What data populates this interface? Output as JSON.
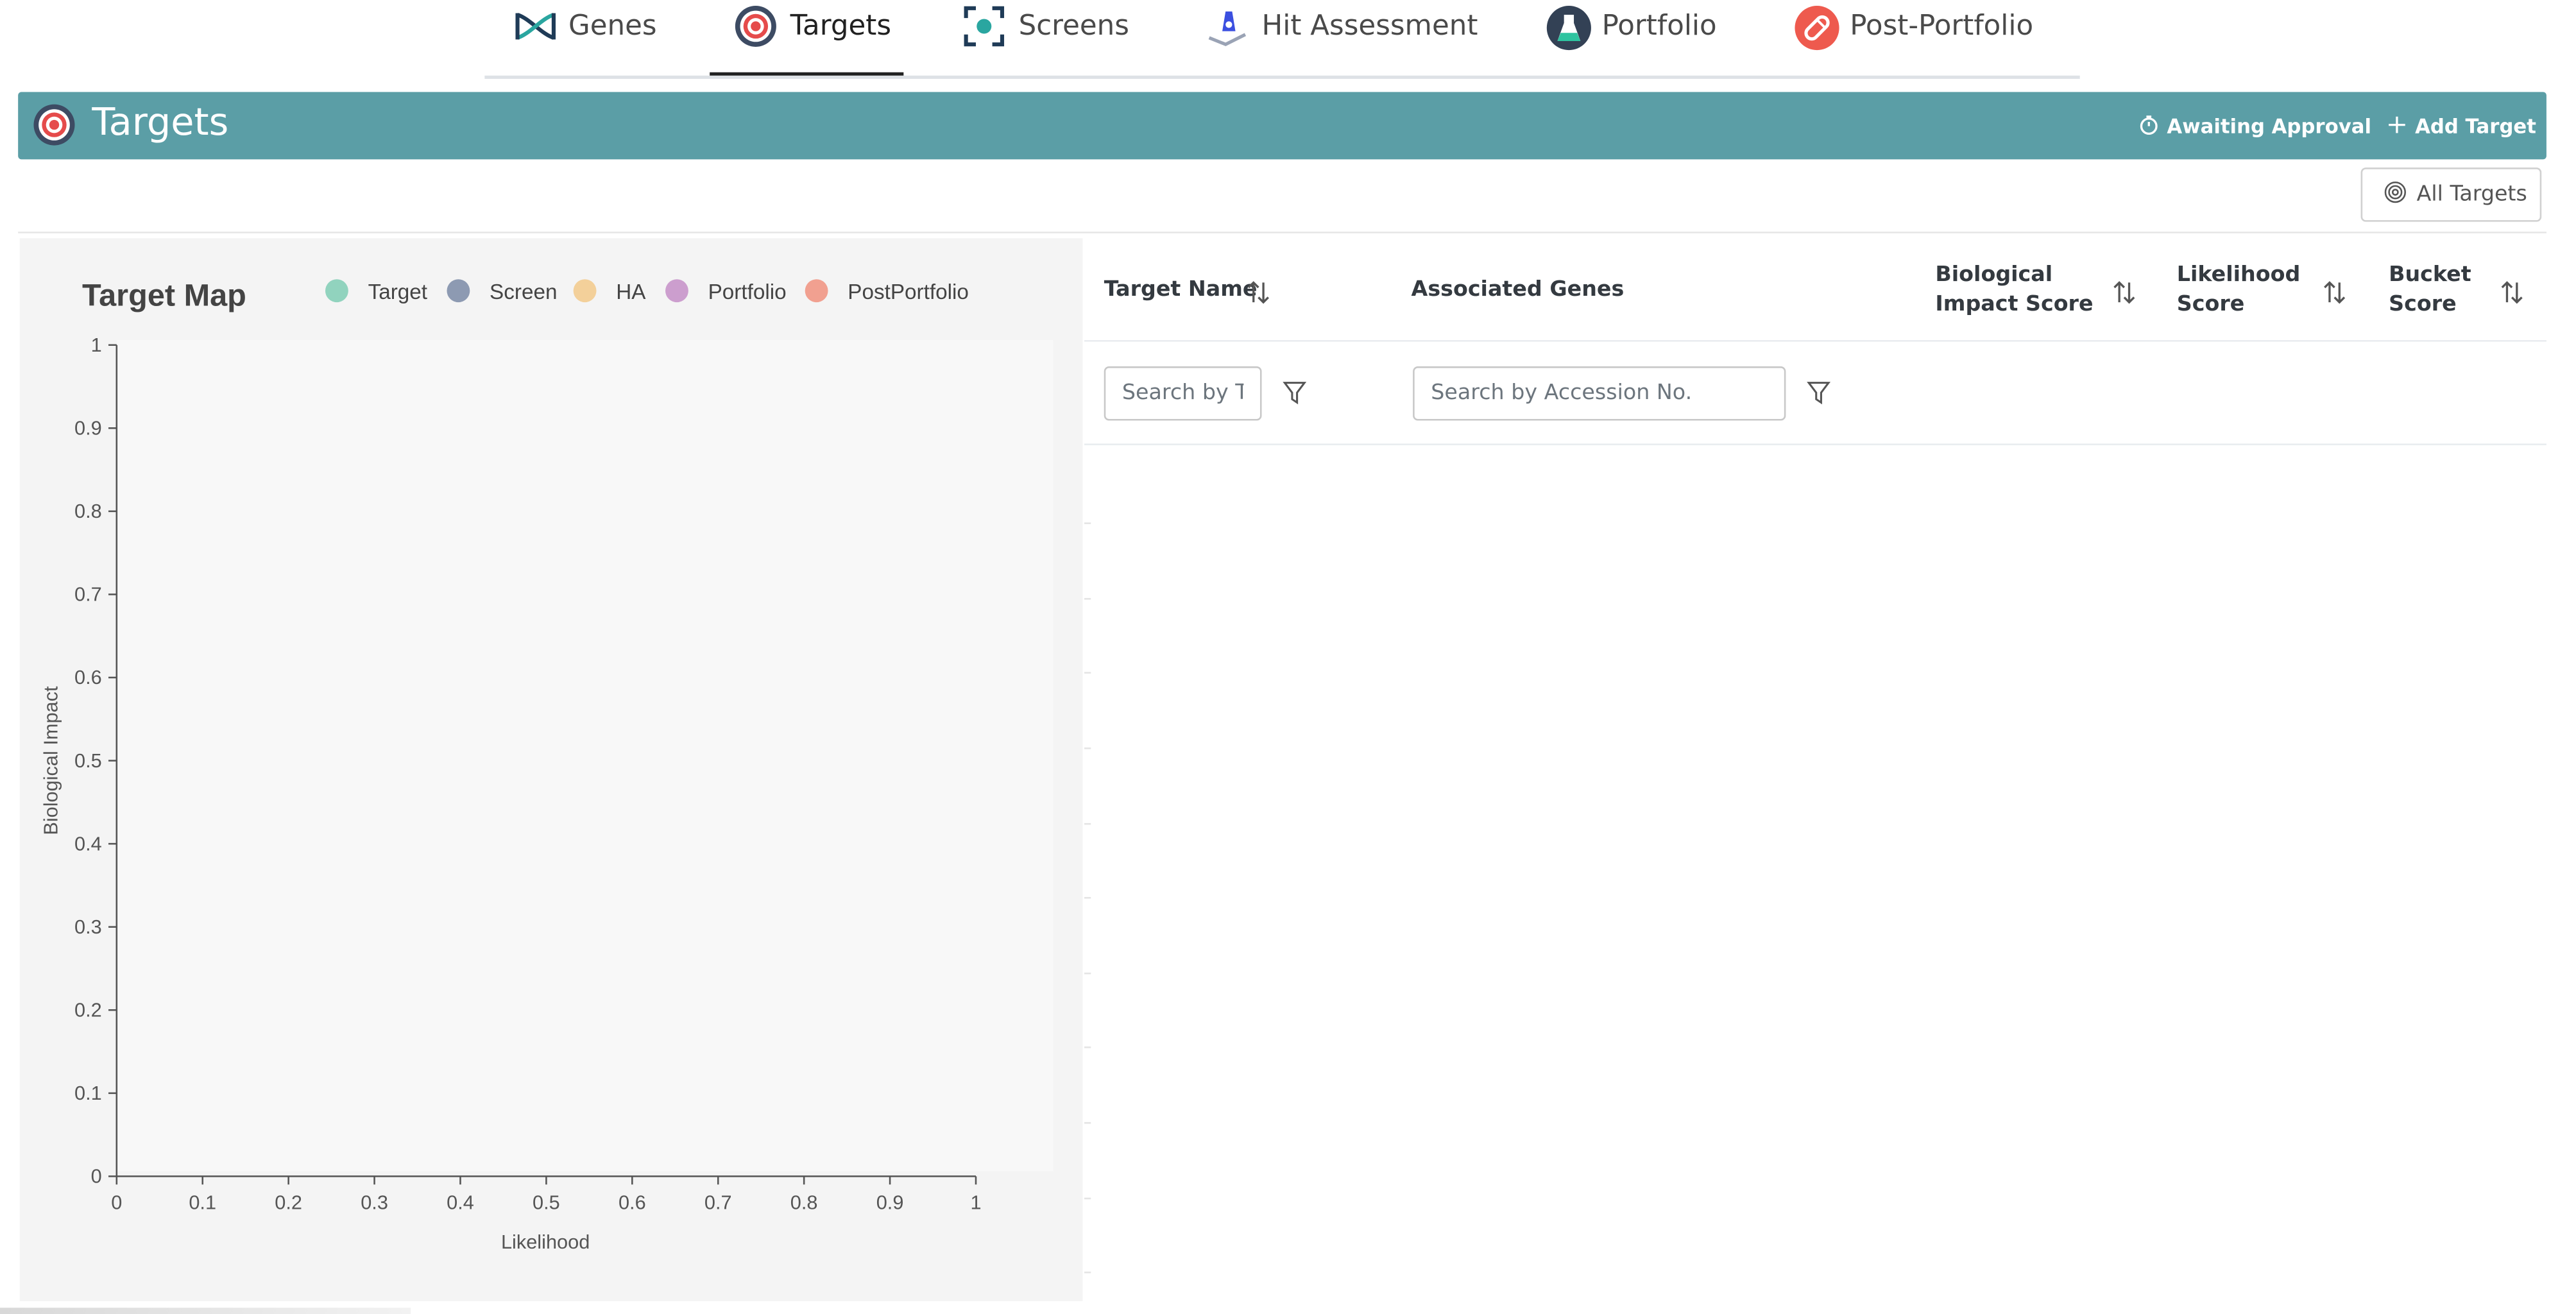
{
  "nav": {
    "items": [
      {
        "label": "Genes",
        "icon": "dna-icon"
      },
      {
        "label": "Targets",
        "icon": "target-icon",
        "active": true
      },
      {
        "label": "Screens",
        "icon": "screen-scan-icon"
      },
      {
        "label": "Hit Assessment",
        "icon": "flask-hand-icon"
      },
      {
        "label": "Portfolio",
        "icon": "portfolio-flask-icon"
      },
      {
        "label": "Post-Portfolio",
        "icon": "pill-icon"
      }
    ]
  },
  "header": {
    "title": "Targets",
    "awaiting_approval": "Awaiting Approval",
    "add_target": "Add Target",
    "bar_color": "#5b9ea6"
  },
  "all_targets_button": "All Targets",
  "chart_data": {
    "type": "scatter",
    "title": "Target Map",
    "xlabel": "Likelihood",
    "ylabel": "Biological Impact",
    "xlim": [
      0,
      1
    ],
    "ylim": [
      0,
      1
    ],
    "x_ticks": [
      "0",
      "0.1",
      "0.2",
      "0.3",
      "0.4",
      "0.5",
      "0.6",
      "0.7",
      "0.8",
      "0.9",
      "1"
    ],
    "y_ticks": [
      "0",
      "0.1",
      "0.2",
      "0.3",
      "0.4",
      "0.5",
      "0.6",
      "0.7",
      "0.8",
      "0.9",
      "1"
    ],
    "legend_position": "top",
    "series": [
      {
        "name": "Target",
        "color": "#7fcdb4",
        "values": []
      },
      {
        "name": "Screen",
        "color": "#7a8aa6",
        "values": []
      },
      {
        "name": "HA",
        "color": "#f2c98a",
        "values": []
      },
      {
        "name": "Portfolio",
        "color": "#c48ec7",
        "values": []
      },
      {
        "name": "PostPortfolio",
        "color": "#f0917e",
        "values": []
      }
    ],
    "grid": false
  },
  "table": {
    "columns": [
      {
        "label": "Target Name",
        "sortable": true
      },
      {
        "label": "Associated Genes",
        "sortable": false
      },
      {
        "label_line1": "Biological",
        "label_line2": "Impact Score",
        "sortable": true
      },
      {
        "label_line1": "Likelihood",
        "label_line2": "Score",
        "sortable": true
      },
      {
        "label_line1": "Bucket",
        "label_line2": "Score",
        "sortable": true
      }
    ],
    "filters": {
      "target_name_placeholder": "Search by Target",
      "accession_placeholder": "Search by Accession No."
    },
    "rows": []
  }
}
